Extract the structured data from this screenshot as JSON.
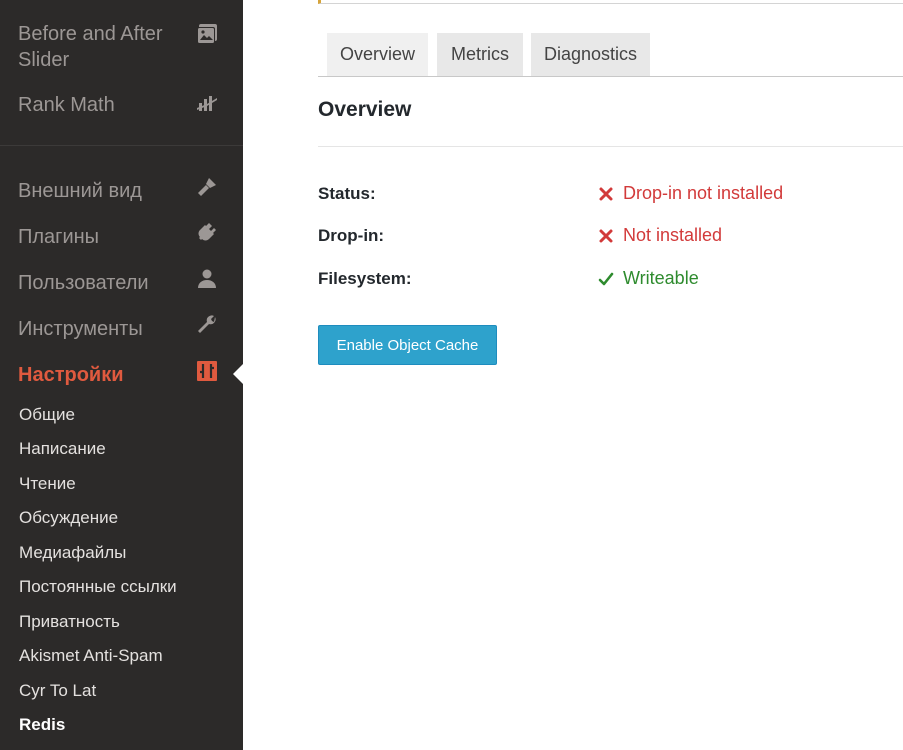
{
  "sidebar": {
    "top_items": [
      {
        "label_line1": "Before and After",
        "label_line2": "Slider",
        "icon": "image-gallery-icon"
      },
      {
        "label": "Rank Math",
        "icon": "chart-icon"
      }
    ],
    "items": [
      {
        "label": "Внешний вид",
        "icon": "brush-icon"
      },
      {
        "label": "Плагины",
        "icon": "plugin-icon"
      },
      {
        "label": "Пользователи",
        "icon": "user-icon"
      },
      {
        "label": "Инструменты",
        "icon": "wrench-icon"
      },
      {
        "label": "Настройки",
        "icon": "settings-icon"
      }
    ],
    "submenu": [
      "Общие",
      "Написание",
      "Чтение",
      "Обсуждение",
      "Медиафайлы",
      "Постоянные ссылки",
      "Приватность",
      "Akismet Anti-Spam",
      "Cyr To Lat",
      "Redis"
    ],
    "active_color": "#e05a3f"
  },
  "main": {
    "tabs": [
      "Overview",
      "Metrics",
      "Diagnostics"
    ],
    "active_tab": "Overview",
    "section_title": "Overview",
    "rows": [
      {
        "label": "Status:",
        "value": "Drop-in not installed",
        "state": "error"
      },
      {
        "label": "Drop-in:",
        "value": "Not installed",
        "state": "error"
      },
      {
        "label": "Filesystem:",
        "value": "Writeable",
        "state": "ok"
      }
    ],
    "button_label": "Enable Object Cache",
    "colors": {
      "error": "#d23a3a",
      "ok": "#2e8b2e",
      "button": "#2ea2cc"
    }
  }
}
